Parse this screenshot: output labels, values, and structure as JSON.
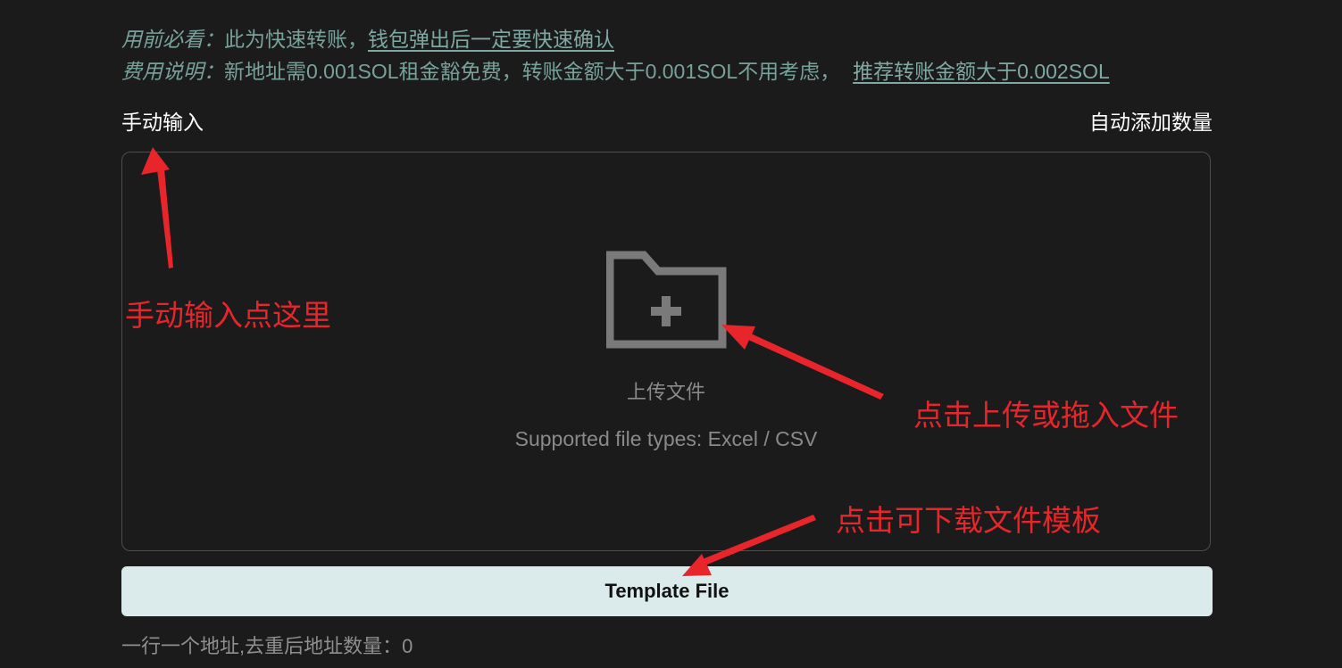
{
  "notice": {
    "line1_lead": "用前必看：",
    "line1_text": "此为快速转账，",
    "line1_link": "钱包弹出后一定要快速确认",
    "line2_lead": "费用说明：",
    "line2_text": "新地址需0.001SOL租金豁免费，转账金额大于0.001SOL不用考虑，",
    "line2_link": "推荐转账金额大于0.002SOL"
  },
  "tabs": {
    "manual_input": "手动输入",
    "auto_add_count": "自动添加数量"
  },
  "upload": {
    "icon": "folder-plus-icon",
    "title": "上传文件",
    "hint": "Supported file types: Excel / CSV"
  },
  "template_button": {
    "label": "Template File"
  },
  "status": {
    "address_count_text": "一行一个地址,去重后地址数量：0"
  },
  "annotations": {
    "manual": "手动输入点这里",
    "upload": "点击上传或拖入文件",
    "template": "点击可下载文件模板"
  },
  "colors": {
    "background": "#1b1b1b",
    "notice_text": "#78a19a",
    "button_bg": "#dbeaea",
    "annotation_red": "#e8252b",
    "icon_gray": "#7a7a7a"
  }
}
